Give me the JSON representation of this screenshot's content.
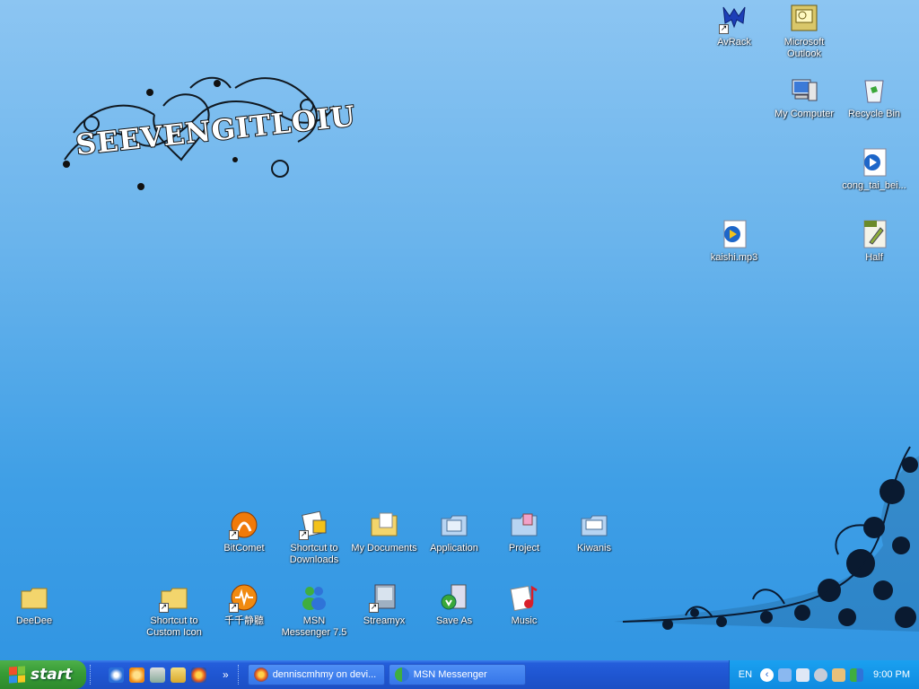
{
  "logo": {
    "text": "SEEVENGITLOIU"
  },
  "top_icons": [
    {
      "name": "avrack",
      "label": "AvRack"
    },
    {
      "name": "outlook",
      "label": "Microsoft\nOutlook"
    },
    {
      "name": "my-computer",
      "label": "My Computer"
    },
    {
      "name": "recycle-bin",
      "label": "Recycle Bin"
    },
    {
      "name": "cong-tai",
      "label": "cong_tai_bei..."
    },
    {
      "name": "kaishi",
      "label": "kaishi.mp3"
    },
    {
      "name": "half",
      "label": "Half"
    }
  ],
  "bottom_row1": [
    {
      "label": "BitComet"
    },
    {
      "label": "Shortcut to\nDownloads"
    },
    {
      "label": "My Documents"
    },
    {
      "label": "Application"
    },
    {
      "label": "Project"
    },
    {
      "label": "Kiwanis"
    }
  ],
  "bottom_row2": [
    {
      "label": "DeeDee"
    },
    {
      "label": "Shortcut to\nCustom Icon"
    },
    {
      "label": "千千静聽"
    },
    {
      "label": "MSN\nMessenger 7.5"
    },
    {
      "label": "Streamyx"
    },
    {
      "label": "Save As"
    },
    {
      "label": "Music"
    }
  ],
  "taskbar": {
    "start_label": "start",
    "more_label": "»",
    "buttons": [
      {
        "label": "denniscmhmy on devi..."
      },
      {
        "label": "MSN Messenger"
      }
    ],
    "lang": "EN",
    "clock": "9:00 PM"
  },
  "colors": {
    "desktop_top": "#8cc5f2",
    "desktop_bottom": "#2f94e2",
    "taskbar": "#245edb",
    "start": "#379b35"
  }
}
